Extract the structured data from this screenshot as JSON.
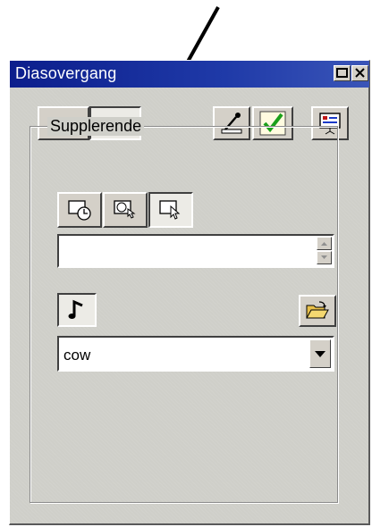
{
  "window": {
    "title": "Diasovergang"
  },
  "icons": {
    "annotation_arrow": "arrow-annotation",
    "effects_tab": "slide-effects-icon",
    "sound_tab": "sound-timing-icon",
    "eyedropper": "eyedropper-icon",
    "apply": "checkmark-icon",
    "preview": "presentation-preview-icon",
    "timing_clock": "clock-advance-icon",
    "timing_click_clock": "click-clock-icon",
    "timing_click": "mouse-click-icon",
    "note": "music-note-icon",
    "open_folder": "open-folder-icon",
    "dropdown": "chevron-down-icon"
  },
  "group": {
    "label": "Supplerende"
  },
  "timing_input": {
    "value": ""
  },
  "sound_select": {
    "value": "cow"
  },
  "colors": {
    "titlebar": "#0c1e8c",
    "face": "#d4d0c8",
    "apply_check": "#1aa01a"
  }
}
